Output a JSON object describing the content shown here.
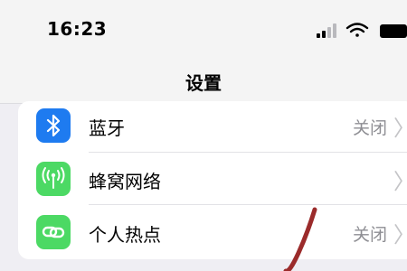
{
  "status_bar": {
    "time": "16:23",
    "icons": [
      "cellular-signal-icon",
      "wifi-icon",
      "battery-icon"
    ]
  },
  "nav": {
    "title": "设置"
  },
  "settings": {
    "rows": [
      {
        "label": "蓝牙",
        "value": "关闭",
        "icon": "bluetooth-icon",
        "color": "#1e7bf0"
      },
      {
        "label": "蜂窝网络",
        "value": "",
        "icon": "cellular-antenna-icon",
        "color": "#4cd964"
      },
      {
        "label": "个人热点",
        "value": "关闭",
        "icon": "personal-hotspot-icon",
        "color": "#4cd964"
      }
    ]
  },
  "annotation": {
    "color": "#9b2b2b"
  }
}
